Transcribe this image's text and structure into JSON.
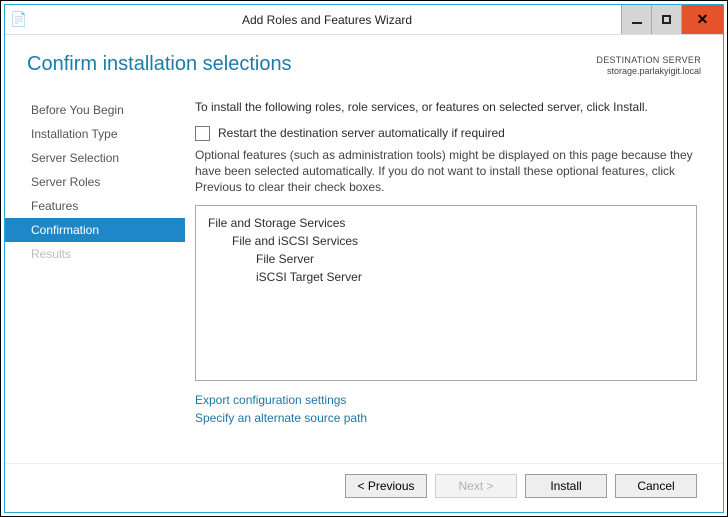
{
  "title": "Add Roles and Features Wizard",
  "header_title": "Confirm installation selections",
  "destination": {
    "label": "DESTINATION SERVER",
    "name": "storage.parlakyigit.local"
  },
  "nav": [
    {
      "label": "Before You Begin",
      "selected": false,
      "disabled": false
    },
    {
      "label": "Installation Type",
      "selected": false,
      "disabled": false
    },
    {
      "label": "Server Selection",
      "selected": false,
      "disabled": false
    },
    {
      "label": "Server Roles",
      "selected": false,
      "disabled": false
    },
    {
      "label": "Features",
      "selected": false,
      "disabled": false
    },
    {
      "label": "Confirmation",
      "selected": true,
      "disabled": false
    },
    {
      "label": "Results",
      "selected": false,
      "disabled": true
    }
  ],
  "instruction": "To install the following roles, role services, or features on selected server, click Install.",
  "restart_checkbox": {
    "label": "Restart the destination server automatically if required",
    "checked": false
  },
  "optional_note": "Optional features (such as administration tools) might be displayed on this page because they have been selected automatically. If you do not want to install these optional features, click Previous to clear their check boxes.",
  "selections": [
    {
      "text": "File and Storage Services",
      "indent": 0
    },
    {
      "text": "File and iSCSI Services",
      "indent": 1
    },
    {
      "text": "File Server",
      "indent": 2
    },
    {
      "text": "iSCSI Target Server",
      "indent": 2
    }
  ],
  "links": {
    "export": "Export configuration settings",
    "altsrc": "Specify an alternate source path"
  },
  "buttons": {
    "previous": "< Previous",
    "next": "Next >",
    "install": "Install",
    "cancel": "Cancel"
  }
}
